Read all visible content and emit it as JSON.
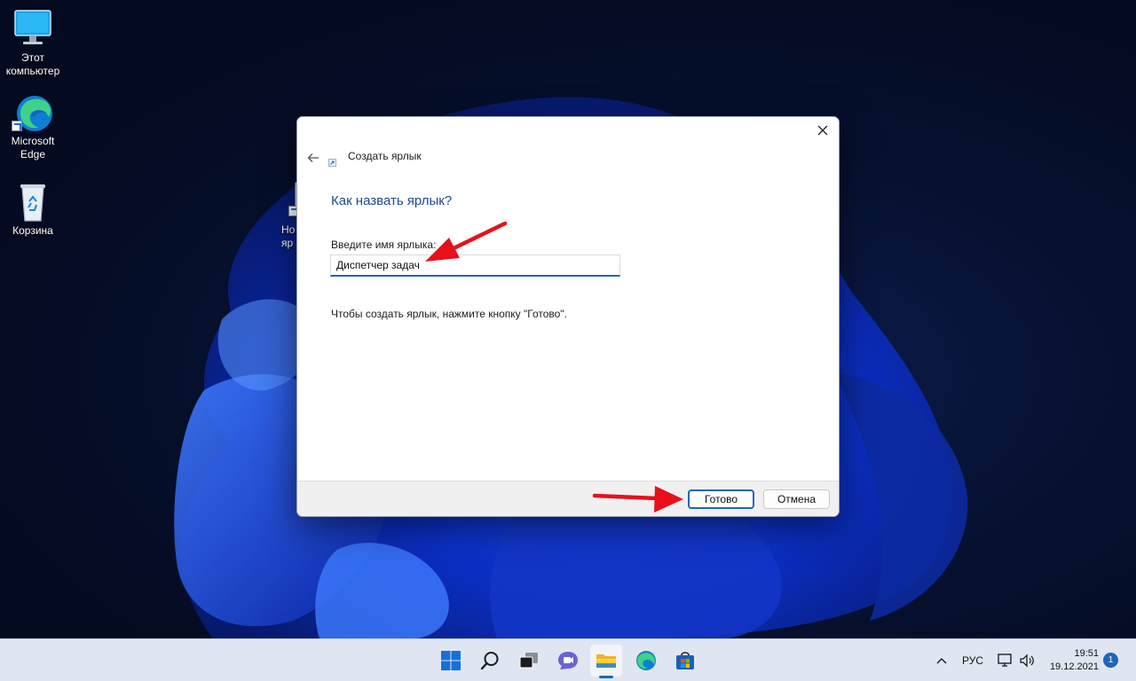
{
  "desktop": {
    "icons": [
      {
        "label": "Этот\nкомпьютер"
      },
      {
        "label": "Microsoft\nEdge"
      },
      {
        "label": "Корзина"
      },
      {
        "label": "Но\nяр"
      }
    ]
  },
  "dialog": {
    "title": "Создать ярлык",
    "heading": "Как назвать ярлык?",
    "field_label": "Введите имя ярлыка:",
    "name_value": "Диспетчер задач",
    "hint": "Чтобы создать ярлык, нажмите кнопку \"Готово\".",
    "done_label": "Готово",
    "cancel_label": "Отмена"
  },
  "taskbar": {
    "language": "РУС",
    "time": "19:51",
    "date": "19.12.2021",
    "notifications": "1"
  },
  "colors": {
    "accent": "#1f66b8",
    "heading": "#1c4b8a",
    "annotation_arrow": "#e8101a"
  }
}
